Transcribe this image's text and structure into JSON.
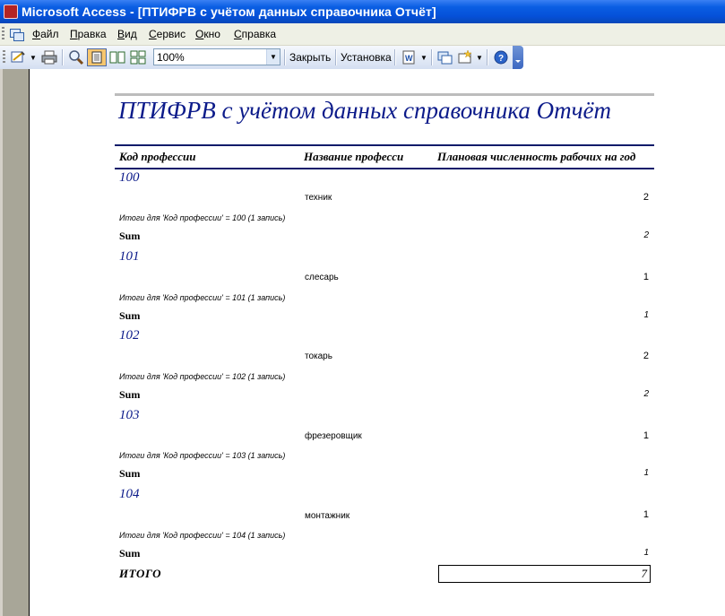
{
  "window": {
    "title": "Microsoft Access - [ПТИФРВ с учётом данных справочника Отчёт]"
  },
  "menu": {
    "items": [
      {
        "label": "Файл"
      },
      {
        "label": "Правка"
      },
      {
        "label": "Вид"
      },
      {
        "label": "Сервис"
      },
      {
        "label": "Окно"
      },
      {
        "label": "Справка"
      }
    ]
  },
  "toolbar": {
    "zoom_value": "100%",
    "close_label": "Закрыть",
    "setup_label": "Установка"
  },
  "report": {
    "title": "ПТИФРВ с учётом данных справочника Отчёт",
    "columns": {
      "code": "Код профессии",
      "name": "Название професси",
      "count": "Плановая численность рабочих на год"
    },
    "groups": [
      {
        "code": "100",
        "name": "техник",
        "value": "2",
        "summary": "Итоги для 'Код профессии' =  100 (1 запись)",
        "sum_label": "Sum",
        "sum": "2"
      },
      {
        "code": "101",
        "name": "слесарь",
        "value": "1",
        "summary": "Итоги для 'Код профессии' =  101 (1 запись)",
        "sum_label": "Sum",
        "sum": "1"
      },
      {
        "code": "102",
        "name": "токарь",
        "value": "2",
        "summary": "Итоги для 'Код профессии' =  102 (1 запись)",
        "sum_label": "Sum",
        "sum": "2"
      },
      {
        "code": "103",
        "name": "фрезеровщик",
        "value": "1",
        "summary": "Итоги для 'Код профессии' =  103 (1 запись)",
        "sum_label": "Sum",
        "sum": "1"
      },
      {
        "code": "104",
        "name": "монтажник",
        "value": "1",
        "summary": "Итоги для 'Код профессии' =  104 (1 запись)",
        "sum_label": "Sum",
        "sum": "1"
      }
    ],
    "total_label": "ИТОГО",
    "total_value": "7"
  }
}
